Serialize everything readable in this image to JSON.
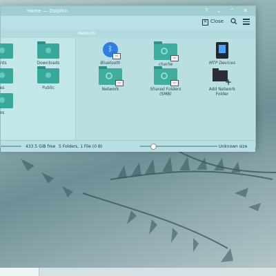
{
  "window": {
    "title": "Home — Dolphin",
    "title_buttons": "? ⌄ ⌃ ✕"
  },
  "toolbar": {
    "close_label": "Close"
  },
  "tabs": {
    "network": "Network"
  },
  "left_pane": {
    "items": [
      {
        "label": "ents",
        "icon": "folder-documents-icon"
      },
      {
        "label": "Downloads",
        "icon": "folder-download-icon"
      },
      {
        "label": "es",
        "icon": "folder-images-icon"
      },
      {
        "label": "Public",
        "icon": "folder-public-icon"
      },
      {
        "label": "os",
        "icon": "folder-videos-icon"
      }
    ]
  },
  "right_pane": {
    "items": [
      {
        "label": "Bluetooth",
        "icon": "bluetooth-icon"
      },
      {
        "label": "charlie",
        "icon": "network-folder-icon"
      },
      {
        "label": "MTP Devices",
        "icon": "mtp-device-icon"
      },
      {
        "label": "Network",
        "icon": "network-folder-icon"
      },
      {
        "label": "Shared Folders",
        "sub": "(SMB)",
        "icon": "network-folder-icon"
      },
      {
        "label": "Add Network",
        "sub": "Folder",
        "icon": "add-network-folder-icon"
      }
    ]
  },
  "status": {
    "free": "433.5 GiB free",
    "info": "5 Folders, 1 File (0 B)",
    "size": "Unknown size"
  }
}
